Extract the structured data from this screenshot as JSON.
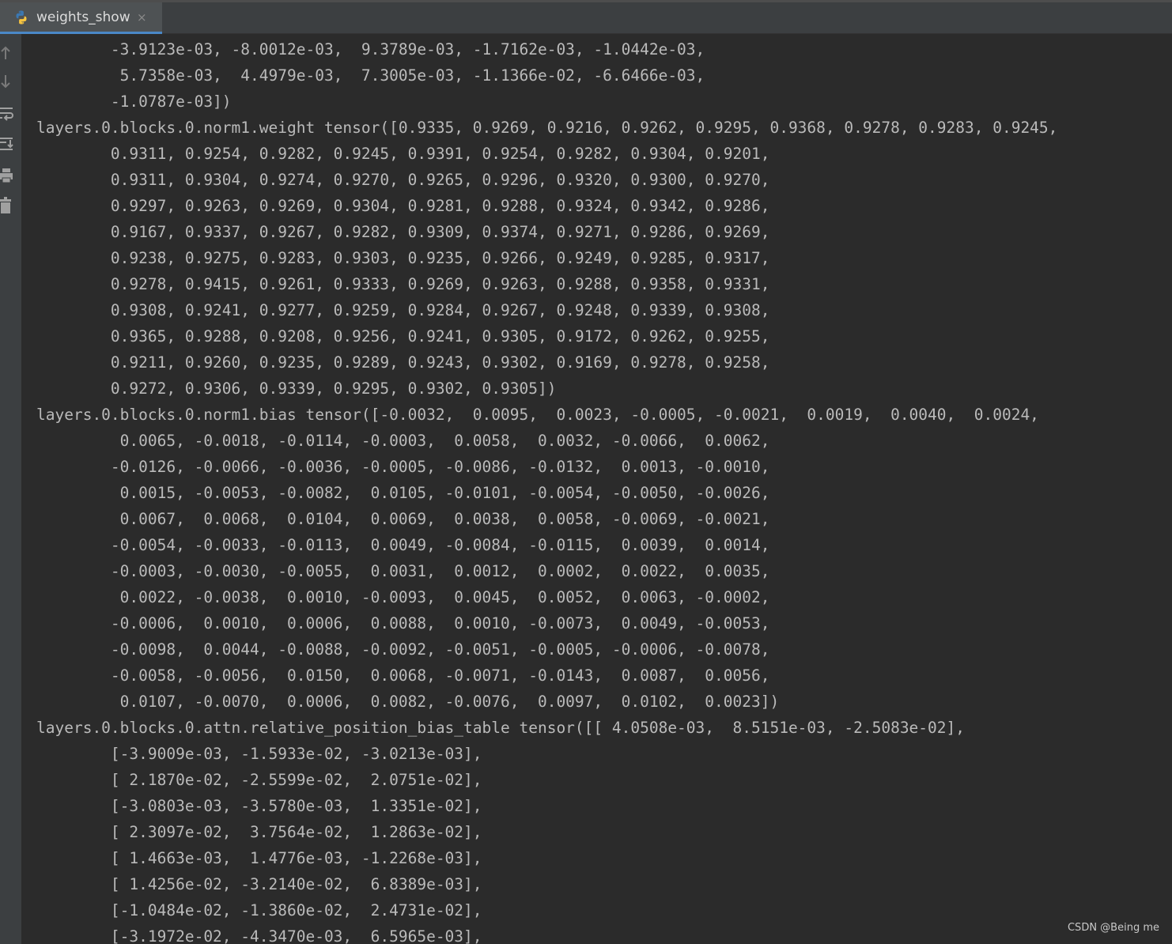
{
  "tab": {
    "label": "weights_show",
    "close_symbol": "×",
    "icon": "python-file-icon"
  },
  "gutter_icons": [
    "scroll-up-icon",
    "scroll-down-icon",
    "soft-wrap-icon",
    "scroll-to-end-icon",
    "print-icon",
    "clear-all-icon"
  ],
  "console_lines": [
    "        -3.9123e-03, -8.0012e-03,  9.3789e-03, -1.7162e-03, -1.0442e-03,",
    "         5.7358e-03,  4.4979e-03,  7.3005e-03, -1.1366e-02, -6.6466e-03,",
    "        -1.0787e-03])",
    "layers.0.blocks.0.norm1.weight tensor([0.9335, 0.9269, 0.9216, 0.9262, 0.9295, 0.9368, 0.9278, 0.9283, 0.9245,",
    "        0.9311, 0.9254, 0.9282, 0.9245, 0.9391, 0.9254, 0.9282, 0.9304, 0.9201,",
    "        0.9311, 0.9304, 0.9274, 0.9270, 0.9265, 0.9296, 0.9320, 0.9300, 0.9270,",
    "        0.9297, 0.9263, 0.9269, 0.9304, 0.9281, 0.9288, 0.9324, 0.9342, 0.9286,",
    "        0.9167, 0.9337, 0.9267, 0.9282, 0.9309, 0.9374, 0.9271, 0.9286, 0.9269,",
    "        0.9238, 0.9275, 0.9283, 0.9303, 0.9235, 0.9266, 0.9249, 0.9285, 0.9317,",
    "        0.9278, 0.9415, 0.9261, 0.9333, 0.9269, 0.9263, 0.9288, 0.9358, 0.9331,",
    "        0.9308, 0.9241, 0.9277, 0.9259, 0.9284, 0.9267, 0.9248, 0.9339, 0.9308,",
    "        0.9365, 0.9288, 0.9208, 0.9256, 0.9241, 0.9305, 0.9172, 0.9262, 0.9255,",
    "        0.9211, 0.9260, 0.9235, 0.9289, 0.9243, 0.9302, 0.9169, 0.9278, 0.9258,",
    "        0.9272, 0.9306, 0.9339, 0.9295, 0.9302, 0.9305])",
    "layers.0.blocks.0.norm1.bias tensor([-0.0032,  0.0095,  0.0023, -0.0005, -0.0021,  0.0019,  0.0040,  0.0024,",
    "         0.0065, -0.0018, -0.0114, -0.0003,  0.0058,  0.0032, -0.0066,  0.0062,",
    "        -0.0126, -0.0066, -0.0036, -0.0005, -0.0086, -0.0132,  0.0013, -0.0010,",
    "         0.0015, -0.0053, -0.0082,  0.0105, -0.0101, -0.0054, -0.0050, -0.0026,",
    "         0.0067,  0.0068,  0.0104,  0.0069,  0.0038,  0.0058, -0.0069, -0.0021,",
    "        -0.0054, -0.0033, -0.0113,  0.0049, -0.0084, -0.0115,  0.0039,  0.0014,",
    "        -0.0003, -0.0030, -0.0055,  0.0031,  0.0012,  0.0002,  0.0022,  0.0035,",
    "         0.0022, -0.0038,  0.0010, -0.0093,  0.0045,  0.0052,  0.0063, -0.0002,",
    "        -0.0006,  0.0010,  0.0006,  0.0088,  0.0010, -0.0073,  0.0049, -0.0053,",
    "        -0.0098,  0.0044, -0.0088, -0.0092, -0.0051, -0.0005, -0.0006, -0.0078,",
    "        -0.0058, -0.0056,  0.0150,  0.0068, -0.0071, -0.0143,  0.0087,  0.0056,",
    "         0.0107, -0.0070,  0.0006,  0.0082, -0.0076,  0.0097,  0.0102,  0.0023])",
    "layers.0.blocks.0.attn.relative_position_bias_table tensor([[ 4.0508e-03,  8.5151e-03, -2.5083e-02],",
    "        [-3.9009e-03, -1.5933e-02, -3.0213e-03],",
    "        [ 2.1870e-02, -2.5599e-02,  2.0751e-02],",
    "        [-3.0803e-03, -3.5780e-03,  1.3351e-02],",
    "        [ 2.3097e-02,  3.7564e-02,  1.2863e-02],",
    "        [ 1.4663e-03,  1.4776e-03, -1.2268e-03],",
    "        [ 1.4256e-02, -3.2140e-02,  6.8389e-03],",
    "        [-1.0484e-02, -1.3860e-02,  2.4731e-02],",
    "        [-3.1972e-02, -4.3470e-03,  6.5965e-03],"
  ],
  "watermark": "CSDN @Being me"
}
